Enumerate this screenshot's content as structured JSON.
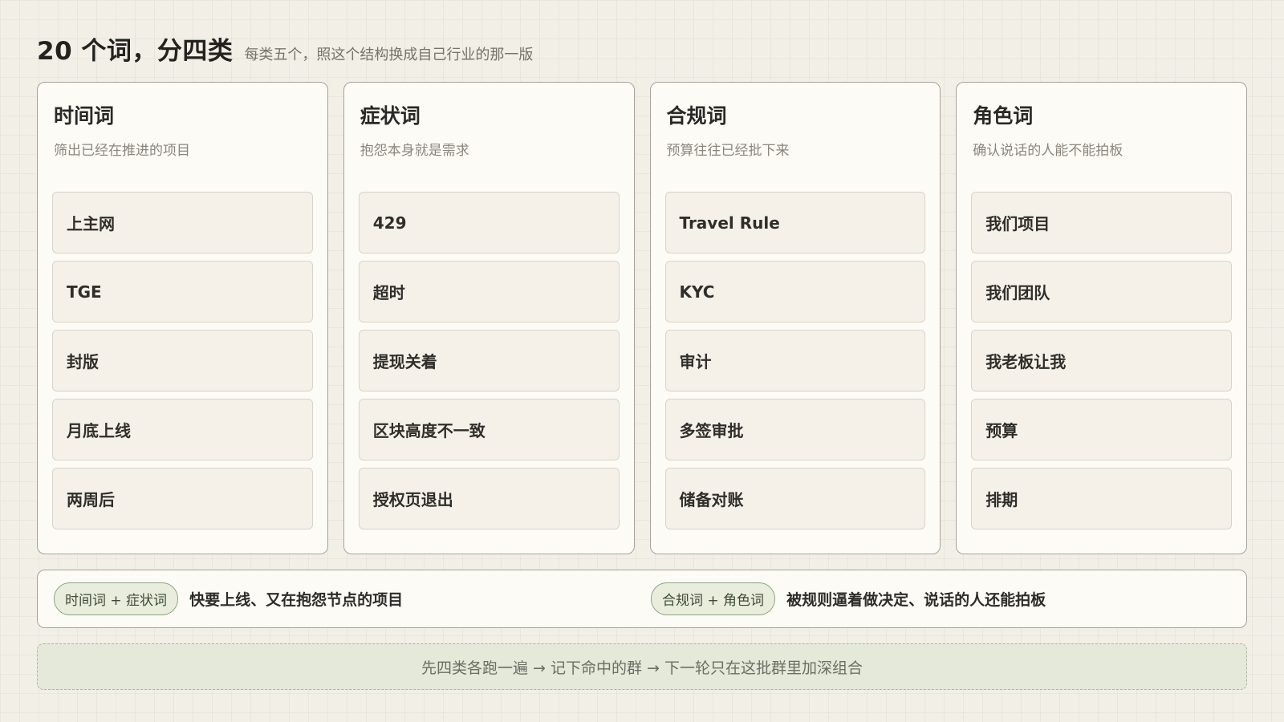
{
  "header": {
    "title": "20 个词，分四类",
    "subtitle": "每类五个，照这个结构换成自己行业的那一版"
  },
  "columns": [
    {
      "title": "时间词",
      "subtitle": "筛出已经在推进的项目",
      "items": [
        "上主网",
        "TGE",
        "封版",
        "月底上线",
        "两周后"
      ]
    },
    {
      "title": "症状词",
      "subtitle": "抱怨本身就是需求",
      "items": [
        "429",
        "超时",
        "提现关着",
        "区块高度不一致",
        "授权页退出"
      ]
    },
    {
      "title": "合规词",
      "subtitle": "预算往往已经批下来",
      "items": [
        "Travel Rule",
        "KYC",
        "审计",
        "多签审批",
        "储备对账"
      ]
    },
    {
      "title": "角色词",
      "subtitle": "确认说话的人能不能拍板",
      "items": [
        "我们项目",
        "我们团队",
        "我老板让我",
        "预算",
        "排期"
      ]
    }
  ],
  "combos": [
    {
      "tag": "时间词 + 症状词",
      "text": "快要上线、又在抱怨节点的项目"
    },
    {
      "tag": "合规词 + 角色词",
      "text": "被规则逼着做决定、说话的人还能拍板"
    }
  ],
  "footer": "先四类各跑一遍 → 记下命中的群 → 下一轮只在这批群里加深组合"
}
